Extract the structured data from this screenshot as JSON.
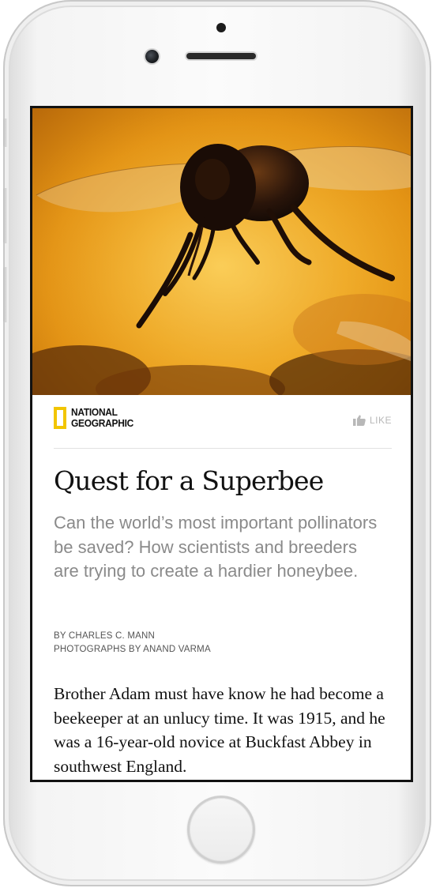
{
  "article": {
    "publisher": {
      "line1": "NATIONAL",
      "line2": "GEOGRAPHIC",
      "brand_color": "#F2C500",
      "icon": "national-geographic-frame-icon"
    },
    "like_label": "LIKE",
    "like_icon": "thumbs-up-icon",
    "title": "Quest for a Superbee",
    "dek": "Can the world’s most important pollinators be saved? How scientists and breeders are trying to create a hardier honeybee.",
    "byline": "BY CHARLES C. MANN",
    "photo_credit": "PHOTOGRAPHS BY ANAND VARMA",
    "body": "Brother Adam must have know he had become a beekeeper at an unlucy time. It was 1915, and he was a 16-year-old novice at Buckfast Abbey in southwest England."
  },
  "colors": {
    "hero_background": "#F2AD25",
    "muted_text": "#8A8A8A",
    "like_text": "#B8B8B8"
  }
}
